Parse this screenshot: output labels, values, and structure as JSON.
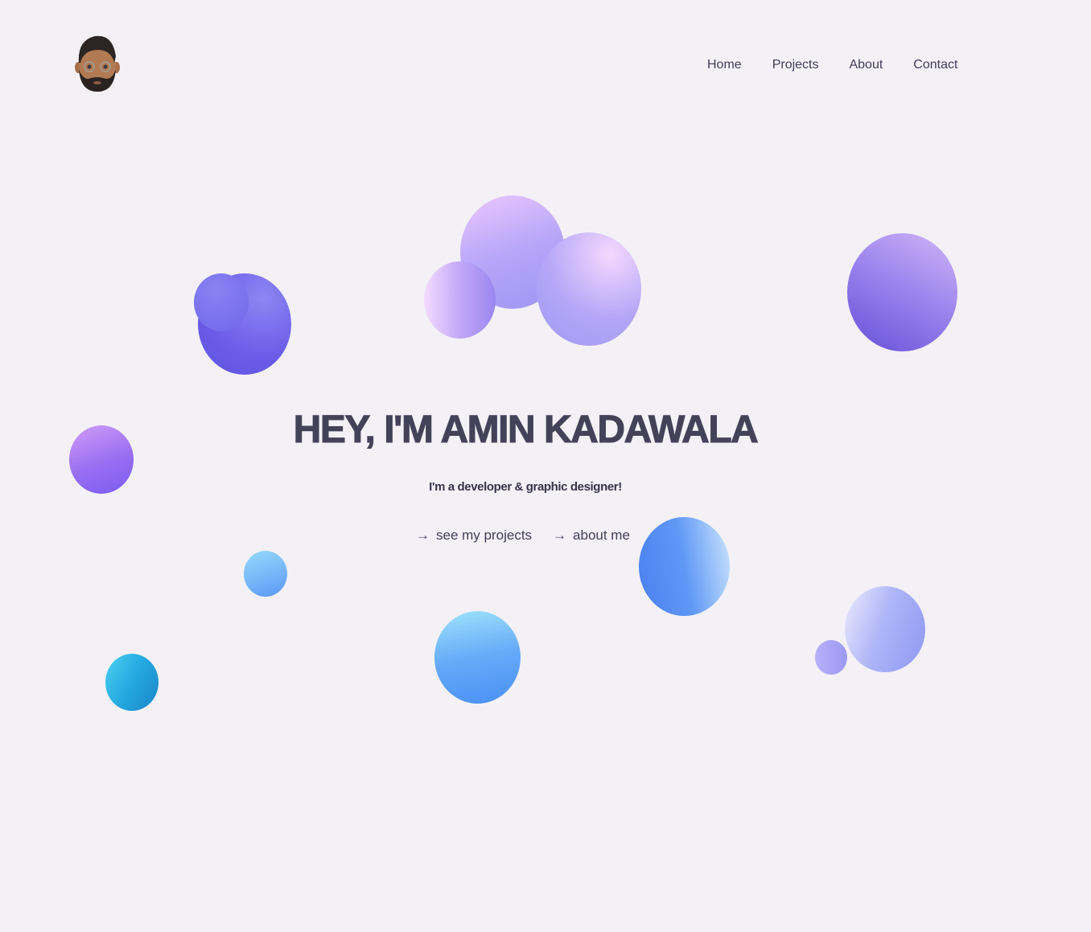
{
  "nav": {
    "items": [
      {
        "label": "Home"
      },
      {
        "label": "Projects"
      },
      {
        "label": "About"
      },
      {
        "label": "Contact"
      }
    ]
  },
  "hero": {
    "title": "HEY, I'M AMIN KADAWALA",
    "subtitle": "I'm a developer & graphic designer!",
    "links": [
      {
        "arrow": "→",
        "label": "see my projects"
      },
      {
        "arrow": "→",
        "label": "about me"
      }
    ]
  },
  "colors": {
    "background": "#f3f1f6",
    "text": "#434258"
  }
}
